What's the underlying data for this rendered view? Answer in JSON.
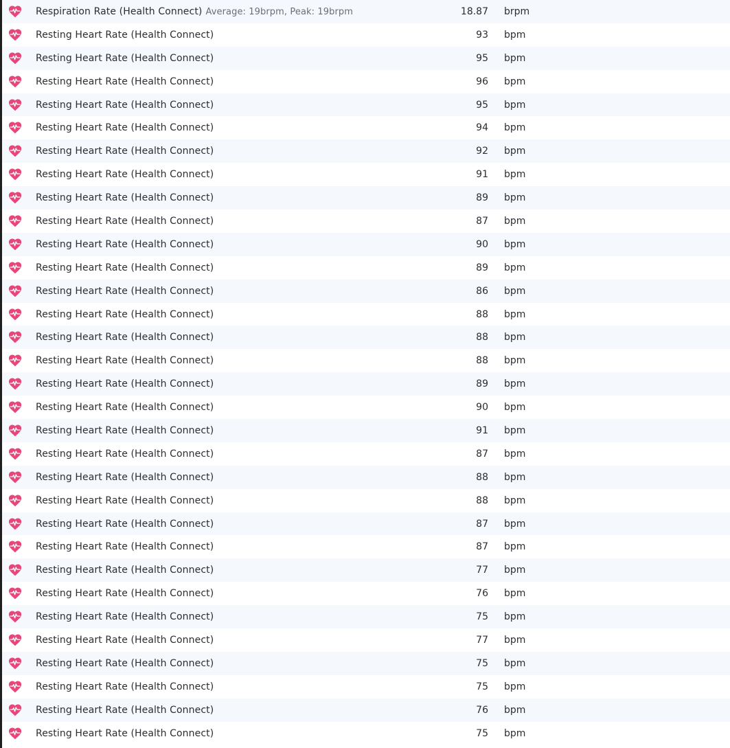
{
  "colors": {
    "heart_icon": "#e8467a",
    "row_alt_background": "#f5f8fc",
    "left_border": "#1f1f1f"
  },
  "icon": "heart-pulse-icon",
  "rows": [
    {
      "label": "Respiration Rate (Health Connect)",
      "meta": "Average: 19brpm, Peak: 19brpm",
      "value": "18.87",
      "unit": "brpm"
    },
    {
      "label": "Resting Heart Rate (Health Connect)",
      "meta": "",
      "value": "93",
      "unit": "bpm"
    },
    {
      "label": "Resting Heart Rate (Health Connect)",
      "meta": "",
      "value": "95",
      "unit": "bpm"
    },
    {
      "label": "Resting Heart Rate (Health Connect)",
      "meta": "",
      "value": "96",
      "unit": "bpm"
    },
    {
      "label": "Resting Heart Rate (Health Connect)",
      "meta": "",
      "value": "95",
      "unit": "bpm"
    },
    {
      "label": "Resting Heart Rate (Health Connect)",
      "meta": "",
      "value": "94",
      "unit": "bpm"
    },
    {
      "label": "Resting Heart Rate (Health Connect)",
      "meta": "",
      "value": "92",
      "unit": "bpm"
    },
    {
      "label": "Resting Heart Rate (Health Connect)",
      "meta": "",
      "value": "91",
      "unit": "bpm"
    },
    {
      "label": "Resting Heart Rate (Health Connect)",
      "meta": "",
      "value": "89",
      "unit": "bpm"
    },
    {
      "label": "Resting Heart Rate (Health Connect)",
      "meta": "",
      "value": "87",
      "unit": "bpm"
    },
    {
      "label": "Resting Heart Rate (Health Connect)",
      "meta": "",
      "value": "90",
      "unit": "bpm"
    },
    {
      "label": "Resting Heart Rate (Health Connect)",
      "meta": "",
      "value": "89",
      "unit": "bpm"
    },
    {
      "label": "Resting Heart Rate (Health Connect)",
      "meta": "",
      "value": "86",
      "unit": "bpm"
    },
    {
      "label": "Resting Heart Rate (Health Connect)",
      "meta": "",
      "value": "88",
      "unit": "bpm"
    },
    {
      "label": "Resting Heart Rate (Health Connect)",
      "meta": "",
      "value": "88",
      "unit": "bpm"
    },
    {
      "label": "Resting Heart Rate (Health Connect)",
      "meta": "",
      "value": "88",
      "unit": "bpm"
    },
    {
      "label": "Resting Heart Rate (Health Connect)",
      "meta": "",
      "value": "89",
      "unit": "bpm"
    },
    {
      "label": "Resting Heart Rate (Health Connect)",
      "meta": "",
      "value": "90",
      "unit": "bpm"
    },
    {
      "label": "Resting Heart Rate (Health Connect)",
      "meta": "",
      "value": "91",
      "unit": "bpm"
    },
    {
      "label": "Resting Heart Rate (Health Connect)",
      "meta": "",
      "value": "87",
      "unit": "bpm"
    },
    {
      "label": "Resting Heart Rate (Health Connect)",
      "meta": "",
      "value": "88",
      "unit": "bpm"
    },
    {
      "label": "Resting Heart Rate (Health Connect)",
      "meta": "",
      "value": "88",
      "unit": "bpm"
    },
    {
      "label": "Resting Heart Rate (Health Connect)",
      "meta": "",
      "value": "87",
      "unit": "bpm"
    },
    {
      "label": "Resting Heart Rate (Health Connect)",
      "meta": "",
      "value": "87",
      "unit": "bpm"
    },
    {
      "label": "Resting Heart Rate (Health Connect)",
      "meta": "",
      "value": "77",
      "unit": "bpm"
    },
    {
      "label": "Resting Heart Rate (Health Connect)",
      "meta": "",
      "value": "76",
      "unit": "bpm"
    },
    {
      "label": "Resting Heart Rate (Health Connect)",
      "meta": "",
      "value": "75",
      "unit": "bpm"
    },
    {
      "label": "Resting Heart Rate (Health Connect)",
      "meta": "",
      "value": "77",
      "unit": "bpm"
    },
    {
      "label": "Resting Heart Rate (Health Connect)",
      "meta": "",
      "value": "75",
      "unit": "bpm"
    },
    {
      "label": "Resting Heart Rate (Health Connect)",
      "meta": "",
      "value": "75",
      "unit": "bpm"
    },
    {
      "label": "Resting Heart Rate (Health Connect)",
      "meta": "",
      "value": "76",
      "unit": "bpm"
    },
    {
      "label": "Resting Heart Rate (Health Connect)",
      "meta": "",
      "value": "75",
      "unit": "bpm"
    }
  ]
}
